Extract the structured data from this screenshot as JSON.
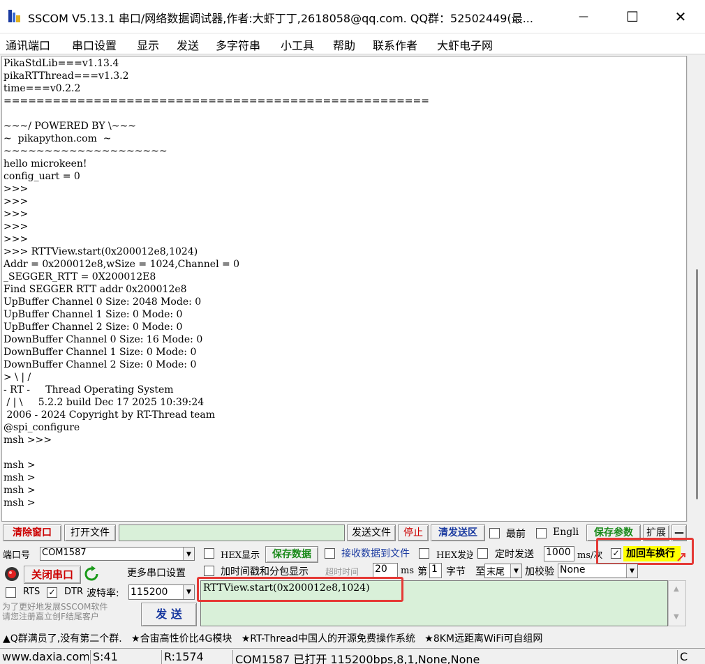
{
  "titlebar": {
    "title": "SSCOM V5.13.1 串口/网络数据调试器,作者:大虾丁丁,2618058@qq.com. QQ群：52502449(最...",
    "minimize": "—",
    "maximize": "☐",
    "close": "✕"
  },
  "menu": [
    "通讯端口",
    "串口设置",
    "显示",
    "发送",
    "多字符串",
    "小工具",
    "帮助",
    "联系作者",
    "大虾电子网"
  ],
  "terminal": {
    "text": "PikaStdLib===v1.13.4\npikaRTThread===v1.3.2\ntime===v0.2.2\n====================================================\n\n~~~/ POWERED BY \\~~~\n~  pikapython.com  ~\n~~~~~~~~~~~~~~~~~~~~\nhello microkeen!\nconfig_uart = 0\n>>>\n>>>\n>>>\n>>>\n>>>\n>>> RTTView.start(0x200012e8,1024)\nAddr = 0x200012e8,wSize = 1024,Channel = 0\n_SEGGER_RTT = 0X200012E8\nFind SEGGER RTT addr 0x200012e8\nUpBuffer Channel 0 Size: 2048 Mode: 0\nUpBuffer Channel 1 Size: 0 Mode: 0\nUpBuffer Channel 2 Size: 0 Mode: 0\nDownBuffer Channel 0 Size: 16 Mode: 0\nDownBuffer Channel 1 Size: 0 Mode: 0\nDownBuffer Channel 2 Size: 0 Mode: 0\n> \\ | /\n- RT -     Thread Operating System\n / | \\     5.2.2 build Dec 17 2025 10:39:24\n 2006 - 2024 Copyright by RT-Thread team\n@spi_configure\nmsh >>>\n\nmsh >\nmsh >\nmsh >\nmsh >"
  },
  "toolbar": {
    "clear_window": "清除窗口",
    "open_file": "打开文件",
    "file_path": "",
    "send_file": "发送文件",
    "stop": "停止",
    "clear_send": "清发送区",
    "topmost": "最前",
    "english": "Engli",
    "save_params": "保存参数",
    "expand": "扩展",
    "dash": "—"
  },
  "port": {
    "label": "端口号",
    "value": "COM1587",
    "close_port": "关闭串口",
    "more_settings": "更多串口设置",
    "rts": "RTS",
    "dtr": "DTR",
    "baud_label": "波特率:",
    "baud_value": "115200"
  },
  "options": {
    "hex_display": "HEX显示",
    "save_data": "保存数据",
    "recv_to_file": "接收数据到文件",
    "hex_send": "HEX发送",
    "timed_send": "定时发送",
    "interval": "1000",
    "interval_unit": "ms/次",
    "add_crlf": "加回车换行",
    "timestamp": "加时间戳和分包显示",
    "timeout_label": "超时时间",
    "timeout_value": "20",
    "ms": "ms",
    "byte_prefix": "第",
    "byte_value": "1",
    "byte_label": "字节",
    "to": "至",
    "end_value": "末尾",
    "checksum_label": "加校验",
    "checksum_value": "None"
  },
  "send": {
    "text": "RTTView.start(0x200012e8,1024)",
    "button": "发 送",
    "promo": "为了更好地发展SSCOM软件\n请您注册嘉立创F结尾客户"
  },
  "ticker": "▲Q群满员了,没有第二个群.   ★合宙高性价比4G模块   ★RT-Thread中国人的开源免费操作系统   ★8KM远距离WiFi可自组网",
  "status": {
    "site": "www.daxia.com",
    "sent": "S:41",
    "recv": "R:1574",
    "port_state": "COM1587 已打开  115200bps,8,1,None,None",
    "cts": "C"
  },
  "colors": {
    "send_area": "#d9f0d9",
    "highlight": "#e53935",
    "crlf_bg": "#ffff00",
    "red_label": "#c00000",
    "green_label": "#1a8a1a"
  }
}
